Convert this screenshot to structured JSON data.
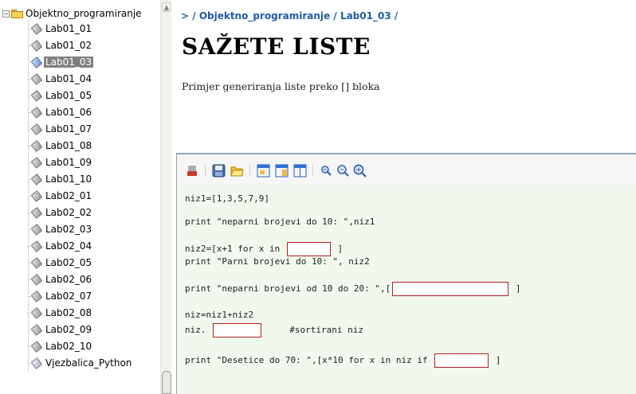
{
  "tree": {
    "root_label": "Objektno_programiranje",
    "items": [
      {
        "label": "Lab01_01",
        "icon": "doc-icon"
      },
      {
        "label": "Lab01_02",
        "icon": "doc-icon"
      },
      {
        "label": "Lab01_03",
        "icon": "doc-icon",
        "selected": true
      },
      {
        "label": "Lab01_04",
        "icon": "doc-icon"
      },
      {
        "label": "Lab01_05",
        "icon": "doc-icon"
      },
      {
        "label": "Lab01_06",
        "icon": "doc-icon"
      },
      {
        "label": "Lab01_07",
        "icon": "doc-icon"
      },
      {
        "label": "Lab01_08",
        "icon": "doc-icon"
      },
      {
        "label": "Lab01_09",
        "icon": "doc-icon"
      },
      {
        "label": "Lab01_10",
        "icon": "doc-icon"
      },
      {
        "label": "Lab02_01",
        "icon": "doc-icon"
      },
      {
        "label": "Lab02_02",
        "icon": "doc-icon"
      },
      {
        "label": "Lab02_03",
        "icon": "doc-icon"
      },
      {
        "label": "Lab02_04",
        "icon": "doc-icon"
      },
      {
        "label": "Lab02_05",
        "icon": "doc-icon"
      },
      {
        "label": "Lab02_06",
        "icon": "doc-icon"
      },
      {
        "label": "Lab02_07",
        "icon": "doc-icon"
      },
      {
        "label": "Lab02_08",
        "icon": "doc-icon"
      },
      {
        "label": "Lab02_09",
        "icon": "doc-icon"
      },
      {
        "label": "Lab02_10",
        "icon": "doc-icon"
      },
      {
        "label": "Vjezbalica_Python",
        "icon": "package-icon"
      }
    ]
  },
  "breadcrumb": {
    "prefix": ">",
    "parts": [
      "Objektno_programiranje",
      "Lab01_03"
    ],
    "separator": "/"
  },
  "page": {
    "title": "SAŽETE LISTE",
    "intro": "Primjer generiranja liste preko [] bloka"
  },
  "toolbar": {
    "buttons": [
      "tool-icon",
      "save-icon",
      "open-folder-icon",
      "window-icon",
      "window-split-icon",
      "window-panel-icon",
      "zoom-out-icon",
      "zoom-reset-icon",
      "zoom-in-icon"
    ]
  },
  "code": {
    "line1": "niz1=[1,3,5,7,9]",
    "line2": "print \"neparni brojevi do 10: \",niz1",
    "line3a": "niz2=[x+1 for x in ",
    "line3b": "]",
    "line4": "print \"Parni brojevi do 10: \", niz2",
    "line5a": "print \"neparni brojevi od 10 do 20: \",[",
    "line5b": "]",
    "line6": "niz=niz1+niz2",
    "line7a": "niz.",
    "line7b": "#sortirani niz",
    "line8a": "print \"Desetice do 70: \",[x*10 for x in niz if ",
    "line8b": "]",
    "blanks": [
      "",
      "",
      "",
      ""
    ]
  },
  "colors": {
    "link": "#1e5ca8",
    "selection": "#808080",
    "code_bg": "#f1f8ee",
    "blank_border": "#b52020"
  }
}
